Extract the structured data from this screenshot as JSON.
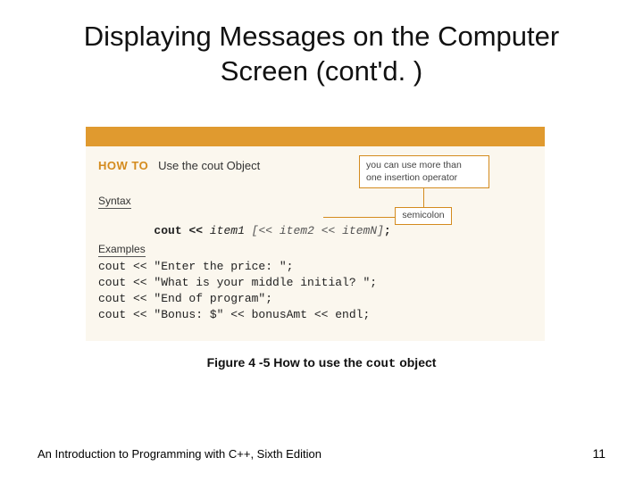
{
  "title_line1": "Displaying Messages on the Computer",
  "title_line2": "Screen (cont'd. )",
  "howto_label": "HOW TO",
  "howto_text": "Use the cout Object",
  "syntax_heading": "Syntax",
  "syntax_cout": "cout",
  "syntax_op1": " << ",
  "syntax_item1": "item1",
  "syntax_opt": " [<< item2 << itemN]",
  "syntax_semi": ";",
  "examples_heading": "Examples",
  "example1": "cout << \"Enter the price: \";",
  "example2": "cout << \"What is your middle initial? \";",
  "example3": "cout << \"End of program\";",
  "example4": "cout << \"Bonus: $\" << bonusAmt << endl;",
  "tip_main_l1": "you can use more than",
  "tip_main_l2": "one insertion operator",
  "tip_semi": "semicolon",
  "caption_a": "Figure 4 -5 How to use the ",
  "caption_code": "cout",
  "caption_b": " object",
  "footer_left": "An Introduction to Programming with C++, Sixth Edition",
  "page_number": "11"
}
